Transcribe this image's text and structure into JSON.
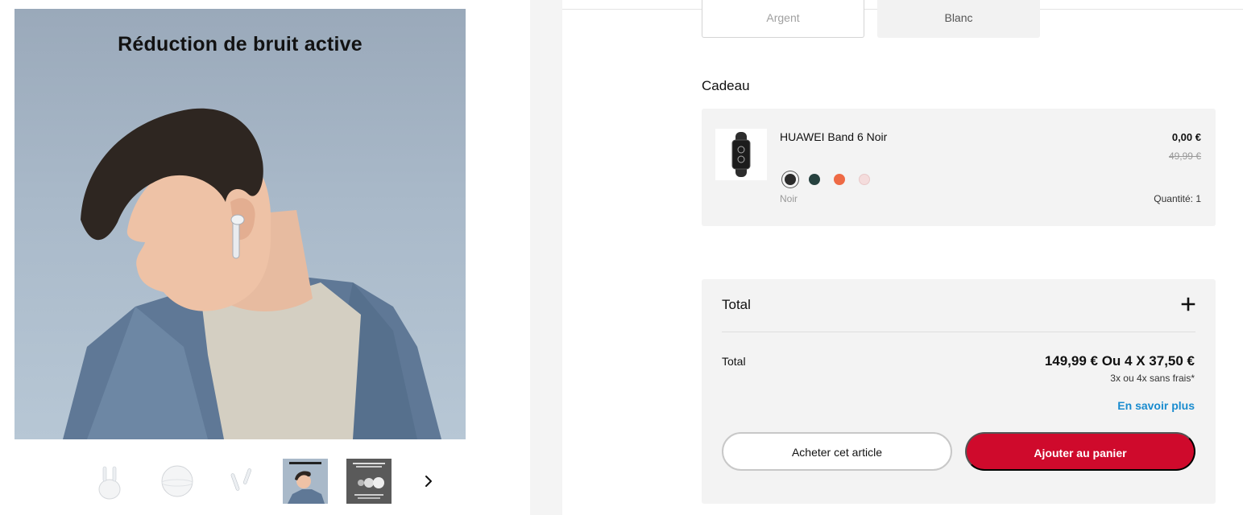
{
  "gallery": {
    "hero_caption": "Réduction de bruit active",
    "thumbnails": [
      {
        "icon": "earbuds-case-icon"
      },
      {
        "icon": "closed-case-icon"
      },
      {
        "icon": "earbuds-pair-icon"
      },
      {
        "icon": "lifestyle-photo-icon",
        "selected": true
      },
      {
        "icon": "feature-photo-icon"
      }
    ],
    "next_icon": "chevron-right-icon"
  },
  "color_options": {
    "argent": "Argent",
    "blanc": "Blanc"
  },
  "gift": {
    "section_title": "Cadeau",
    "product_name": "HUAWEI Band 6 Noir",
    "price": "0,00 €",
    "old_price": "49,99 €",
    "swatches": [
      {
        "name": "Noir",
        "color": "#2b2b2b",
        "selected": true
      },
      {
        "name": "swatch-2",
        "color": "#26413f"
      },
      {
        "name": "swatch-3",
        "color": "#ee6a45"
      },
      {
        "name": "swatch-4",
        "color": "#f4dcdc"
      }
    ],
    "selected_color": "Noir",
    "quantity": "Quantité: 1"
  },
  "total": {
    "header": "Total",
    "expand_icon": "plus-icon",
    "label": "Total",
    "amount": "149,99 € Ou 4 X 37,50 €",
    "installments": "3x ou 4x sans frais*",
    "learn_more": "En savoir plus",
    "buy_button": "Acheter cet article",
    "cart_button": "Ajouter au panier"
  },
  "colors": {
    "accent": "#cf0a2c",
    "link": "#1a8ccf",
    "panel": "#f3f3f3"
  }
}
